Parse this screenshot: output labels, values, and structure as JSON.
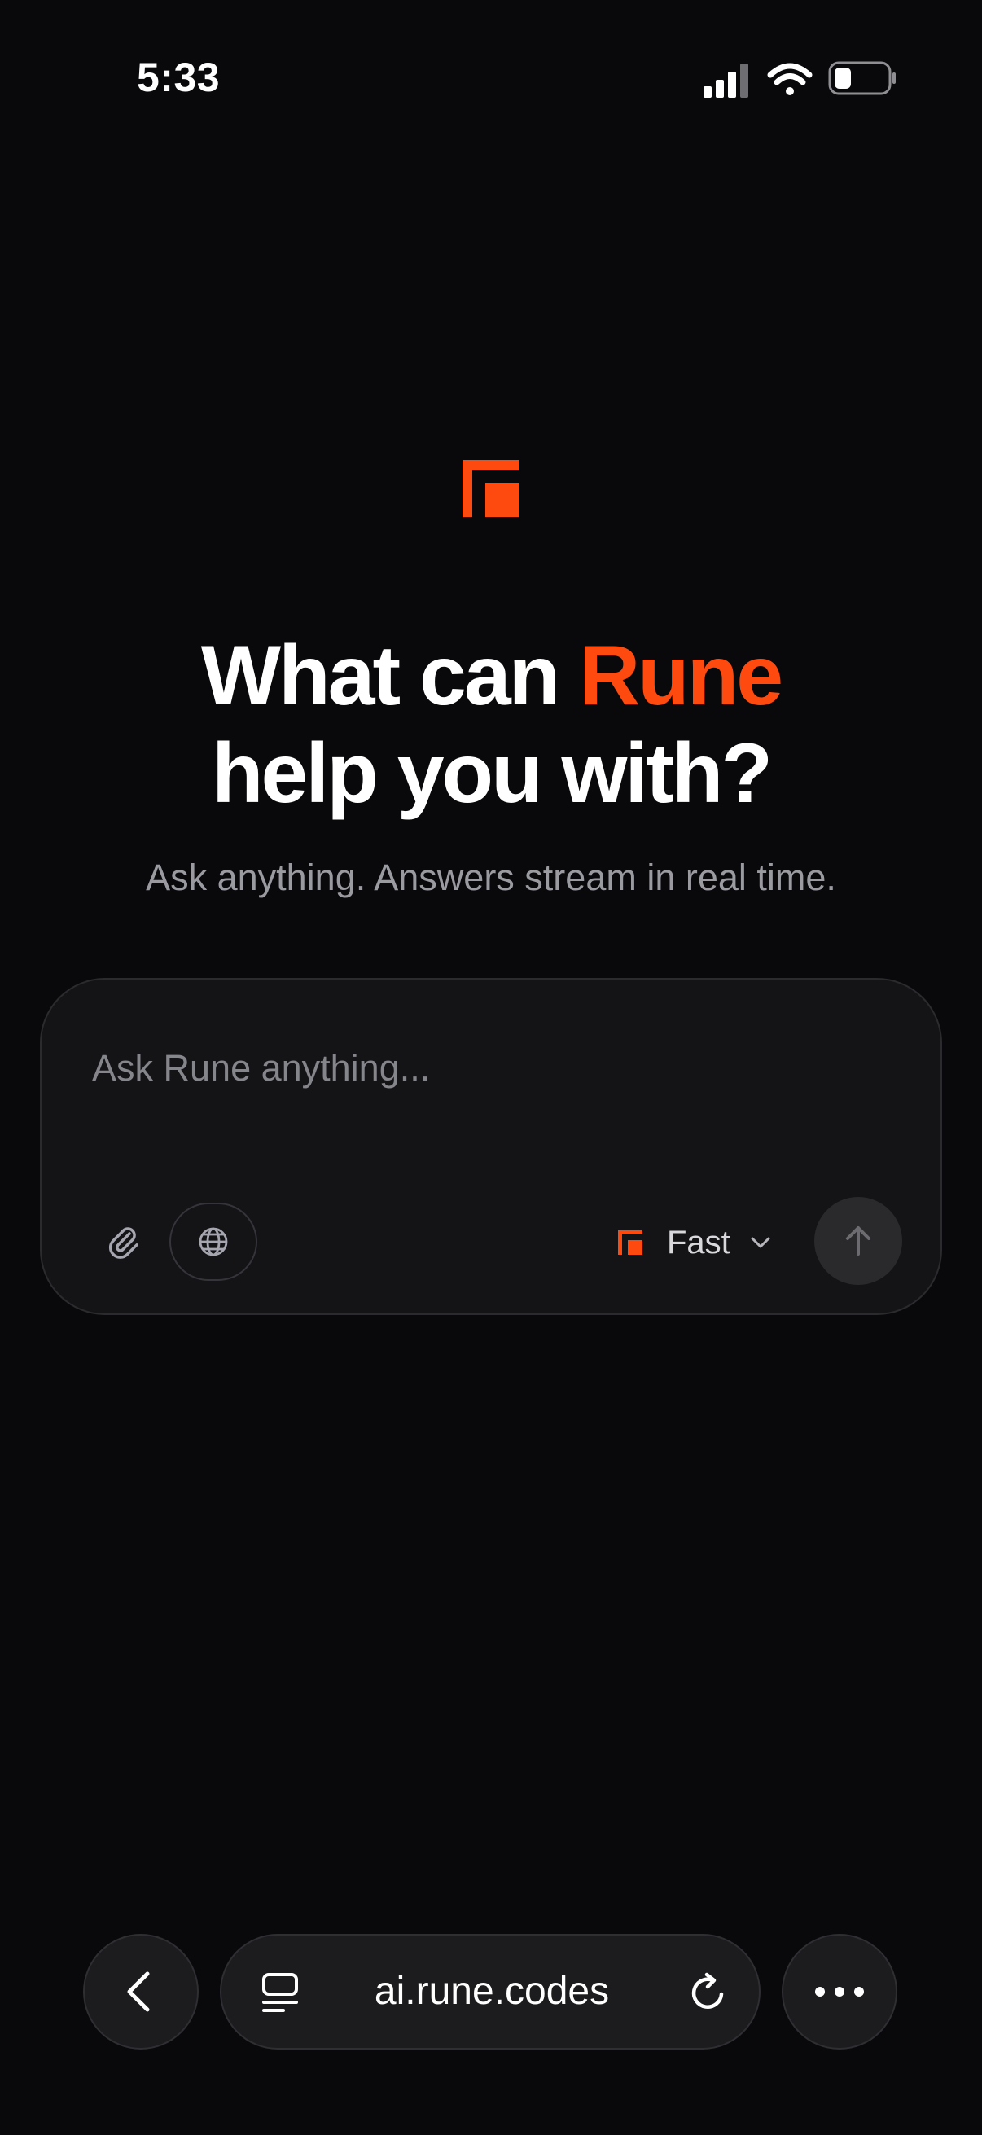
{
  "status_bar": {
    "time": "5:33",
    "icons": [
      "cellular-signal-icon",
      "wifi-icon",
      "battery-icon"
    ]
  },
  "brand": {
    "logo_icon": "rune-logo-icon",
    "accent_color": "#ff4a0f"
  },
  "hero": {
    "headline_part1": "What can ",
    "headline_accent": "Rune",
    "headline_part2": "help you with?",
    "subtitle": "Ask anything. Answers stream in real time."
  },
  "composer": {
    "placeholder": "Ask Rune anything...",
    "value": "",
    "attach_icon": "paperclip-icon",
    "web_search_icon": "globe-icon",
    "model_label": "Fast",
    "model_dropdown_icon": "chevron-down-icon",
    "send_icon": "arrow-up-icon"
  },
  "browser_bar": {
    "back_icon": "chevron-left-icon",
    "tabs_icon": "tabs-icon",
    "url": "ai.rune.codes",
    "reload_icon": "reload-icon",
    "more_icon": "more-icon"
  }
}
